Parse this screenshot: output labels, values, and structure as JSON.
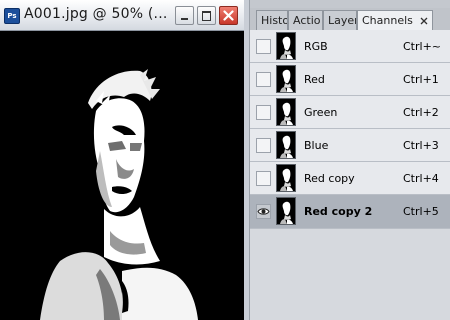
{
  "document": {
    "app_icon_text": "Ps",
    "title": "A001.jpg @ 50% (...",
    "controls": {
      "minimize": "minimize",
      "maximize": "maximize",
      "close": "close"
    }
  },
  "panel": {
    "tabs": [
      {
        "label": "Histo"
      },
      {
        "label": "Actio"
      },
      {
        "label": "Layer"
      },
      {
        "label": "Channels",
        "active": true
      }
    ],
    "channels": [
      {
        "name": "RGB",
        "shortcut": "Ctrl+~",
        "visible": false,
        "selected": false
      },
      {
        "name": "Red",
        "shortcut": "Ctrl+1",
        "visible": false,
        "selected": false
      },
      {
        "name": "Green",
        "shortcut": "Ctrl+2",
        "visible": false,
        "selected": false
      },
      {
        "name": "Blue",
        "shortcut": "Ctrl+3",
        "visible": false,
        "selected": false
      },
      {
        "name": "Red copy",
        "shortcut": "Ctrl+4",
        "visible": false,
        "selected": false
      },
      {
        "name": "Red copy 2",
        "shortcut": "Ctrl+5",
        "visible": true,
        "selected": true
      }
    ]
  },
  "colors": {
    "selected_row": "#adb3bc",
    "close_button": "#c8372a",
    "canvas": "#000000"
  }
}
